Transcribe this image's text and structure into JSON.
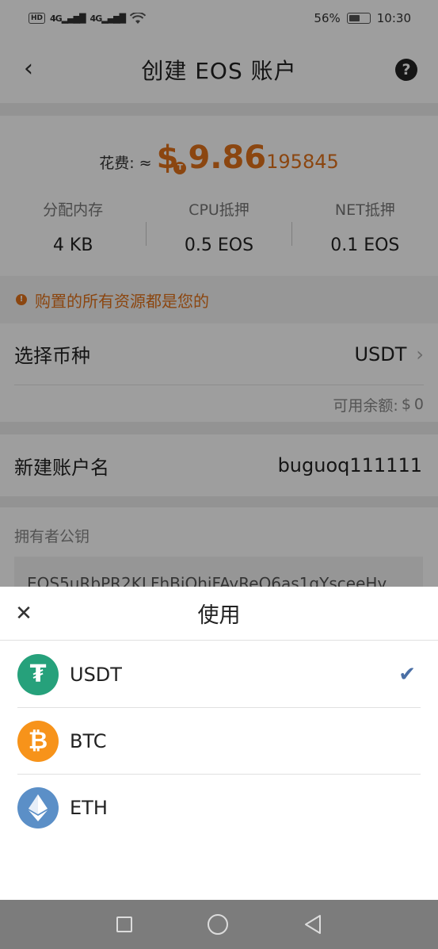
{
  "status_bar": {
    "hd": "HD",
    "sim1": "4G",
    "sim2": "4G",
    "battery_percent": "56%",
    "battery_level": 0.56,
    "time": "10:30"
  },
  "header": {
    "title": "创建 EOS 账户"
  },
  "cost": {
    "label": "花费: ≈",
    "amount_main": "9.86",
    "amount_decimals": "195845",
    "currency_badge": "T",
    "accent_color": "#e0721a"
  },
  "stats": [
    {
      "label": "分配内存",
      "value": "4 KB"
    },
    {
      "label": "CPU抵押",
      "value": "0.5 EOS"
    },
    {
      "label": "NET抵押",
      "value": "0.1 EOS"
    }
  ],
  "notice": {
    "text": "购置的所有资源都是您的"
  },
  "coin_select": {
    "label": "选择币种",
    "value": "USDT",
    "balance_label": "可用余额:",
    "balance_value": "0"
  },
  "account": {
    "label": "新建账户名",
    "value": "buguoq111111"
  },
  "owner_key": {
    "label": "拥有者公钥",
    "value": "EOS5uRbPR2KLFhBiQhiFAyReQ6as1gYsceeHy"
  },
  "sheet": {
    "title": "使用",
    "options": [
      {
        "name": "USDT",
        "icon": "tether-icon",
        "color": "#26a17b",
        "glyph": "₮",
        "selected": true
      },
      {
        "name": "BTC",
        "icon": "bitcoin-icon",
        "color": "#f7931a",
        "glyph": "₿",
        "selected": false
      },
      {
        "name": "ETH",
        "icon": "ethereum-icon",
        "color": "#5b8fc7",
        "glyph": "◆",
        "selected": false
      }
    ],
    "check_color": "#4a6fa5"
  }
}
